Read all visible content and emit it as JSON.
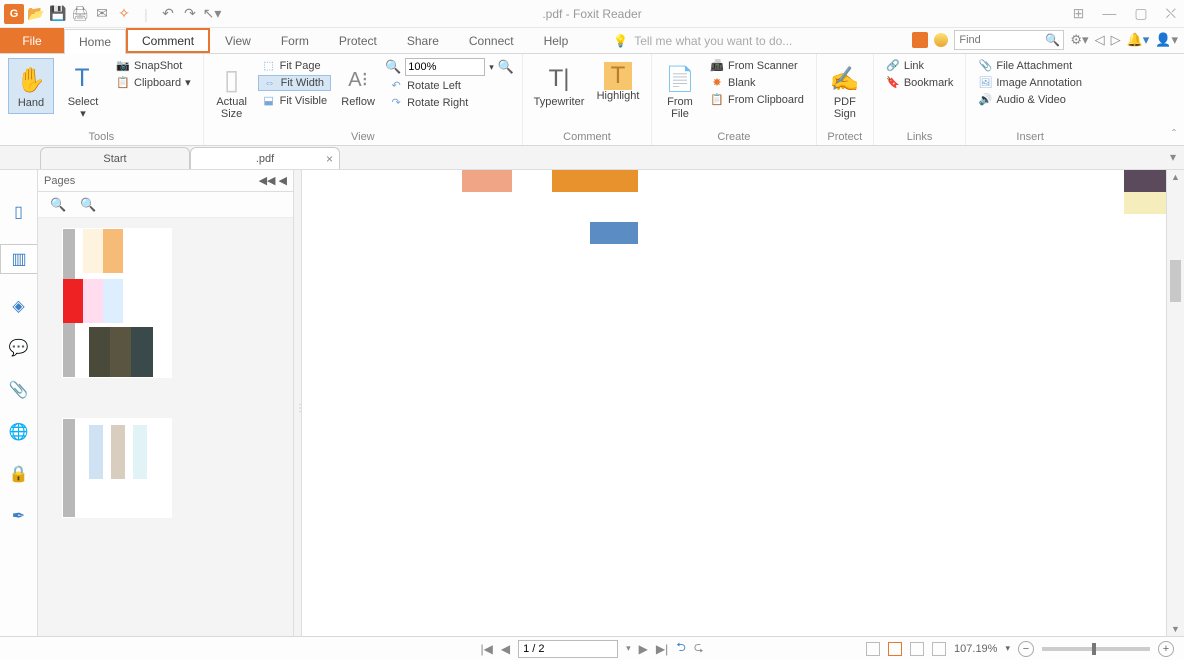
{
  "app": {
    "title": ".pdf - Foxit Reader"
  },
  "tabs": {
    "file": "File",
    "items": [
      "Home",
      "Comment",
      "View",
      "Form",
      "Protect",
      "Share",
      "Connect",
      "Help"
    ],
    "active": "Home",
    "highlighted": "Comment",
    "tellme_placeholder": "Tell me what you want to do...",
    "find_placeholder": "Find"
  },
  "ribbon": {
    "tools": {
      "label": "Tools",
      "hand": "Hand",
      "select": "Select",
      "snapshot": "SnapShot",
      "clipboard": "Clipboard"
    },
    "view": {
      "label": "View",
      "actual": "Actual\nSize",
      "fitpage": "Fit Page",
      "fitwidth": "Fit Width",
      "fitvisible": "Fit Visible",
      "reflow": "Reflow",
      "zoom_value": "100%",
      "rotate_left": "Rotate Left",
      "rotate_right": "Rotate Right"
    },
    "comment": {
      "label": "Comment",
      "typewriter": "Typewriter",
      "highlight": "Highlight"
    },
    "create": {
      "label": "Create",
      "fromfile": "From\nFile",
      "scanner": "From Scanner",
      "blank": "Blank",
      "clipboard": "From Clipboard"
    },
    "protect": {
      "label": "Protect",
      "pdfsign": "PDF\nSign"
    },
    "links": {
      "label": "Links",
      "link": "Link",
      "bookmark": "Bookmark"
    },
    "insert": {
      "label": "Insert",
      "attachment": "File Attachment",
      "imageannot": "Image Annotation",
      "audiovideo": "Audio & Video"
    }
  },
  "doctabs": {
    "start": "Start",
    "doc": ".pdf"
  },
  "pages": {
    "label": "Pages"
  },
  "status": {
    "page": "1 / 2",
    "zoom": "107.19%"
  }
}
